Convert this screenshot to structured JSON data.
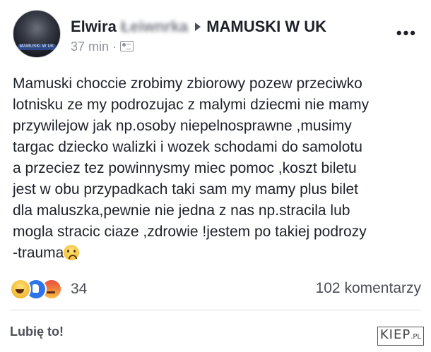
{
  "post": {
    "author_name": "Elwira",
    "author_surname_obscured": "Łeiwnrka",
    "group_name": "MAMUSKI W UK",
    "time": "37 min",
    "more_label": "•••",
    "avatar_text": "MAMUSKI W UK",
    "text": "Mamuski choccie zrobimy zbiorowy pozew przeciwko\nlotnisku ze my podrozujac z malymi dziecmi nie mamy\nprzywilejow jak np.osoby niepelnosprawne ,musimy\ntargac dziecko walizki i wozek schodami do samolotu\na przeciez tez powinnysmy miec pomoc ,koszt biletu\njest w obu przypadkach taki sam my mamy plus bilet\ndla maluszka,pewnie nie jedna z nas np.stracila lub\nmogla stracic ciaze ,zdrowie !jestem po takiej podrozy\n-trauma",
    "trailing_emoji": "worried-face-emoji"
  },
  "reactions": {
    "icons": [
      "haha",
      "like",
      "angry"
    ],
    "count": "34"
  },
  "comments_label": "102 komentarzy",
  "like_button_label": "Lubię to!",
  "watermark": {
    "main": "KIEP",
    "suffix": ".PL"
  },
  "colors": {
    "text": "#1d2129",
    "muted": "#90949c",
    "like_blue": "#2d74e8"
  }
}
